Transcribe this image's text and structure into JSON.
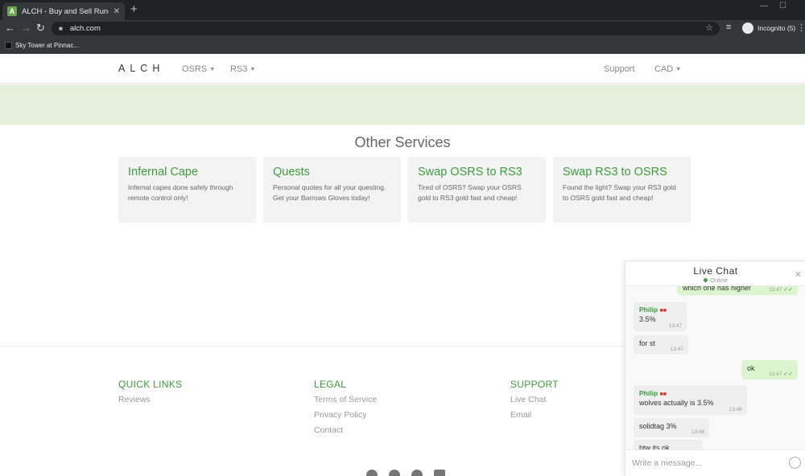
{
  "browser": {
    "tab_title": "ALCH - Buy and Sell Runescape G",
    "favicon_letter": "A",
    "url": "alch.com",
    "incognito_label": "Incognito (5)",
    "bookmark": "Sky Tower at Pinnac..."
  },
  "header": {
    "brand": "ALCH",
    "nav": [
      {
        "label": "OSRS"
      },
      {
        "label": "RS3"
      }
    ],
    "support": "Support",
    "currency": "CAD"
  },
  "services": {
    "title": "Other Services",
    "cards": [
      {
        "title": "Infernal Cape",
        "desc": "Infernal capes done safely through remote control only!"
      },
      {
        "title": "Quests",
        "desc": "Personal quotes for all your questing. Get your Barrows Gloves today!"
      },
      {
        "title": "Swap OSRS to RS3",
        "desc": "Tired of OSRS? Swap your OSRS gold to RS3 gold fast and cheap!"
      },
      {
        "title": "Swap RS3 to OSRS",
        "desc": "Found the light? Swap your RS3 gold to OSRS gold fast and cheap!"
      }
    ]
  },
  "footer": {
    "quick_links": {
      "title": "QUICK LINKS",
      "links": [
        "Reviews"
      ]
    },
    "legal": {
      "title": "LEGAL",
      "links": [
        "Terms of Service",
        "Privacy Policy",
        "Contact"
      ]
    },
    "support": {
      "title": "SUPPORT",
      "links": [
        "Live Chat",
        "Email"
      ]
    }
  },
  "chat": {
    "title": "Live Chat",
    "status": "Online",
    "placeholder": "Write a message...",
    "messages": [
      {
        "dir": "out",
        "text": "which one has higher",
        "time": "13:47"
      },
      {
        "dir": "in",
        "sender": "Philip",
        "text": "3.5%",
        "time": "13:47"
      },
      {
        "dir": "in",
        "text": "for st",
        "time": "13:47"
      },
      {
        "dir": "out",
        "text": "ok",
        "time": "13:47"
      },
      {
        "dir": "in",
        "sender": "Philip",
        "text": "wolves actually is 3.5%",
        "time": "13:48"
      },
      {
        "dir": "in",
        "text": "solidtag 3%",
        "time": "13:48"
      },
      {
        "dir": "in",
        "text": "btw its ok",
        "time": ""
      }
    ]
  }
}
